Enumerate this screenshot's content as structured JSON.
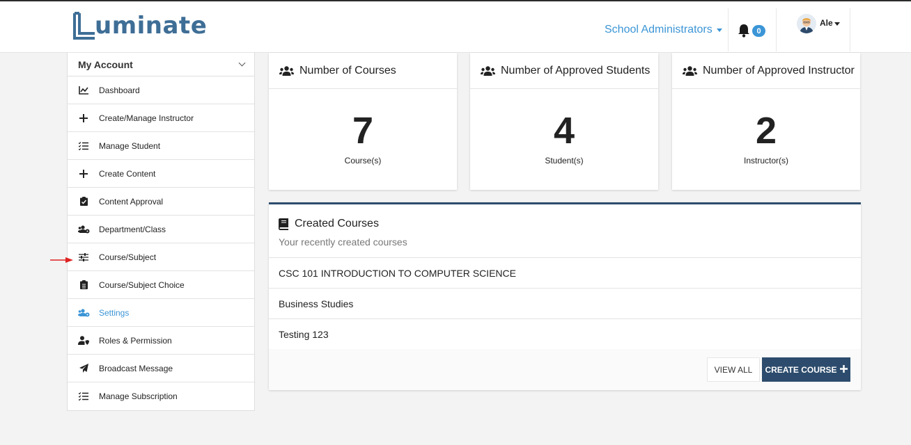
{
  "header": {
    "logo_text": "uminate",
    "role_menu": "School Administrators",
    "notification_count": "0",
    "user_name": "Ale"
  },
  "sidebar": {
    "title": "My Account",
    "items": [
      {
        "label": "Dashboard",
        "icon": "chart-line-icon"
      },
      {
        "label": "Create/Manage Instructor",
        "icon": "plus-icon"
      },
      {
        "label": "Manage Student",
        "icon": "tasks-icon"
      },
      {
        "label": "Create Content",
        "icon": "plus-icon"
      },
      {
        "label": "Content Approval",
        "icon": "clipboard-check-icon"
      },
      {
        "label": "Department/Class",
        "icon": "users-cog-icon"
      },
      {
        "label": "Course/Subject",
        "icon": "sliders-icon"
      },
      {
        "label": "Course/Subject Choice",
        "icon": "clipboard-list-icon"
      },
      {
        "label": "Settings",
        "icon": "users-cog-icon",
        "active": true
      },
      {
        "label": "Roles & Permission",
        "icon": "user-shield-icon"
      },
      {
        "label": "Broadcast Message",
        "icon": "paper-plane-icon"
      },
      {
        "label": "Manage Subscription",
        "icon": "tasks-icon"
      }
    ]
  },
  "stats": [
    {
      "title": "Number of Courses",
      "value": "7",
      "unit": "Course(s)"
    },
    {
      "title": "Number of Approved Students",
      "value": "4",
      "unit": "Student(s)"
    },
    {
      "title": "Number of Approved Instructor",
      "value": "2",
      "unit": "Instructor(s)"
    }
  ],
  "courses": {
    "title": "Created Courses",
    "subtitle": "Your recently created courses",
    "rows": [
      "CSC 101 INTRODUCTION TO COMPUTER SCIENCE",
      "Business Studies",
      "Testing 123"
    ],
    "view_all": "VIEW ALL",
    "create": "CREATE COURSE"
  },
  "colors": {
    "accent": "#3b95d6",
    "navy": "#2d4c6d",
    "annotation_arrow": "#e02020"
  }
}
